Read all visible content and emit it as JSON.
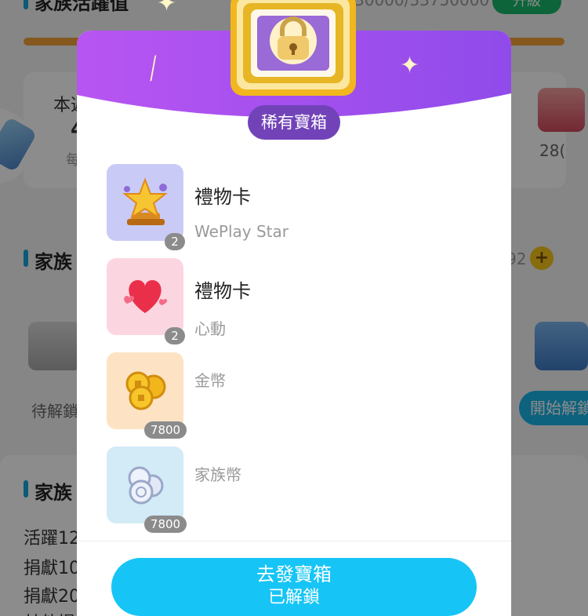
{
  "background": {
    "top_title": "家族活躍值",
    "top_counter": "30000/33750000",
    "upgrade_button": "升級",
    "card_label_1": "本週",
    "card_label_2": "4",
    "card_label_3": "每",
    "card_right_value": "28(",
    "family_section_title": "家族",
    "family_count": "92",
    "pending_label": "待解鎖",
    "start_unlock_button": "開始解鎖",
    "family_section_title_2": "家族",
    "activity_lines": [
      "活躍12",
      "捐獻10",
      "捐獻20",
      "其他提"
    ]
  },
  "modal": {
    "chest_label": "稀有寶箱",
    "items": [
      {
        "title": "禮物卡",
        "subtitle": "WePlay Star",
        "quantity": "2",
        "thumb_color": "#c9cbf6",
        "icon": "star-trophy-icon"
      },
      {
        "title": "禮物卡",
        "subtitle": "心動",
        "quantity": "2",
        "thumb_color": "#fbd6e0",
        "icon": "heart-icon"
      },
      {
        "title": "",
        "subtitle": "金幣",
        "quantity": "7800",
        "thumb_color": "#fde3c4",
        "icon": "gold-coins-icon"
      },
      {
        "title": "",
        "subtitle": "家族幣",
        "quantity": "7800",
        "thumb_color": "#d3eaf7",
        "icon": "silver-coins-icon"
      }
    ],
    "cta_line1": "去發寶箱",
    "cta_line2": "已解鎖"
  },
  "colors": {
    "header_purple_start": "#b855f2",
    "header_purple_end": "#8a48e8",
    "cta_cyan": "#16c5f6",
    "pill_purple": "#7243b8"
  }
}
